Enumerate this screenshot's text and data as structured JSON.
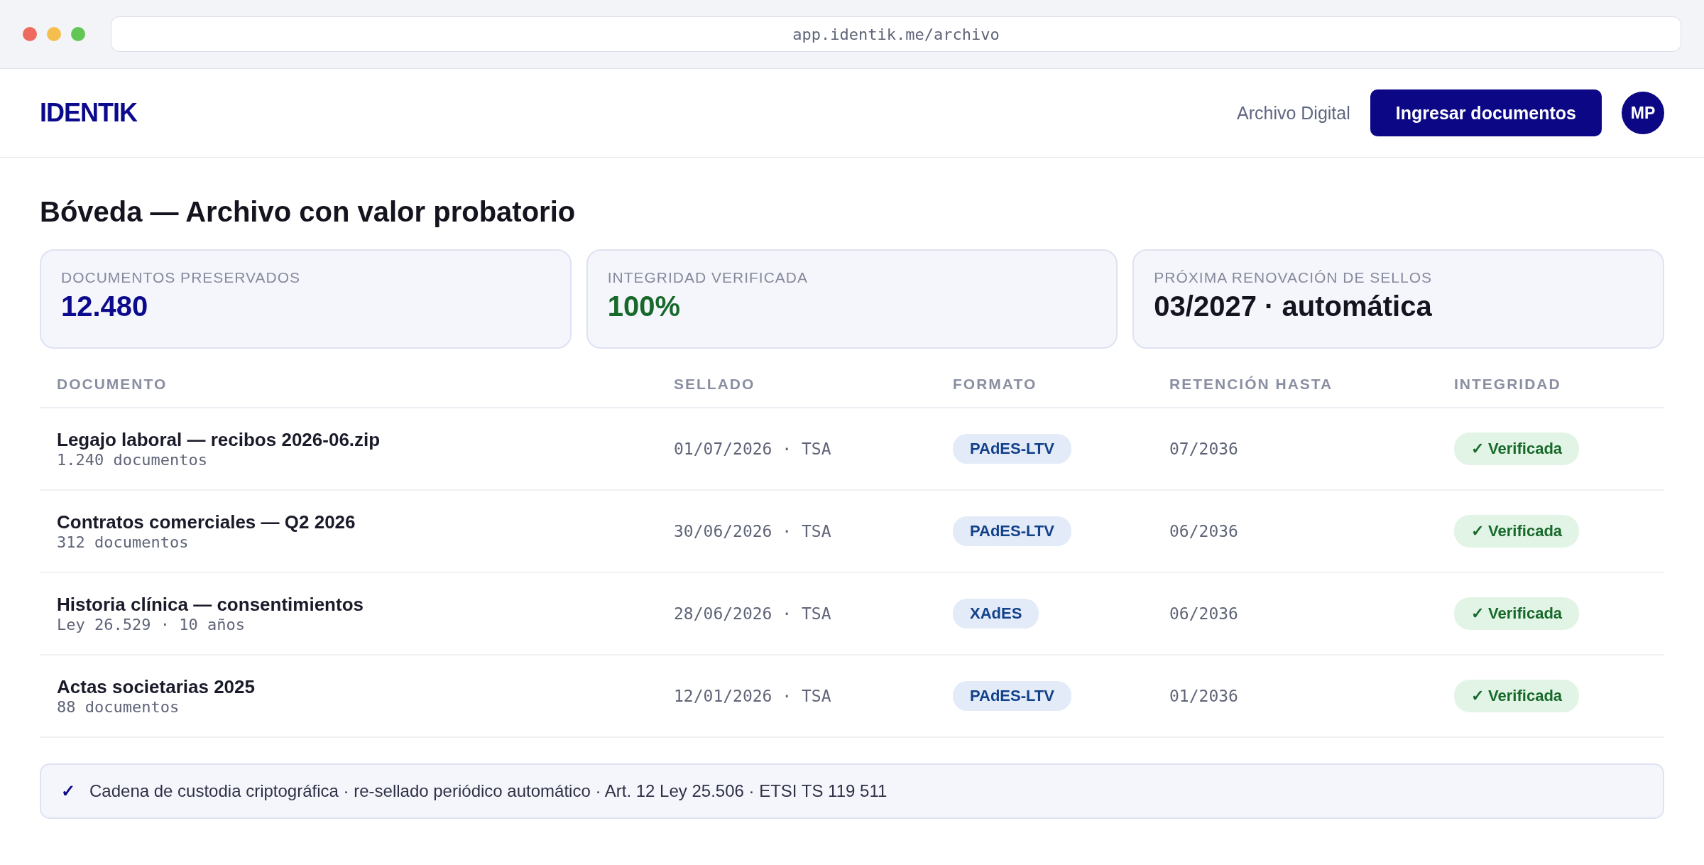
{
  "browser": {
    "url": "app.identik.me/archivo"
  },
  "header": {
    "logo": "IDENTIK",
    "nav_link": "Archivo Digital",
    "cta": "Ingresar documentos",
    "avatar": "MP"
  },
  "title": "Bóveda — Archivo con valor probatorio",
  "stats": [
    {
      "label": "DOCUMENTOS PRESERVADOS",
      "value": "12.480",
      "color": "#0b0a8c"
    },
    {
      "label": "INTEGRIDAD VERIFICADA",
      "value": "100%",
      "color": "#17692a"
    },
    {
      "label": "PRÓXIMA RENOVACIÓN DE SELLOS",
      "value": "03/2027 · automática",
      "color": "#14141f"
    }
  ],
  "table": {
    "columns": [
      "DOCUMENTO",
      "SELLADO",
      "FORMATO",
      "RETENCIÓN HASTA",
      "INTEGRIDAD"
    ],
    "rows": [
      {
        "name": "Legajo laboral — recibos 2026-06.zip",
        "detail": "1.240 documentos",
        "sealed": "01/07/2026 · TSA",
        "format": "PAdES-LTV",
        "retention": "07/2036",
        "integrity": {
          "label": "✓ Verificada",
          "verified": true
        }
      },
      {
        "name": "Contratos comerciales — Q2 2026",
        "detail": "312 documentos",
        "sealed": "30/06/2026 · TSA",
        "format": "PAdES-LTV",
        "retention": "06/2036",
        "integrity": {
          "label": "✓ Verificada",
          "verified": true
        }
      },
      {
        "name": "Historia clínica — consentimientos",
        "detail": "Ley 26.529 · 10 años",
        "sealed": "28/06/2026 · TSA",
        "format": "XAdES",
        "retention": "06/2036",
        "integrity": {
          "label": "✓ Verificada",
          "verified": true
        }
      },
      {
        "name": "Actas societarias 2025",
        "detail": "88 documentos",
        "sealed": "12/01/2026 · TSA",
        "format": "PAdES-LTV",
        "retention": "01/2036",
        "integrity": {
          "label": "✓ Verificada",
          "verified": true
        }
      }
    ]
  },
  "footer": {
    "mark": "✓",
    "text": "Cadena de custodia criptográfica · re-sellado periódico automático · Art. 12 Ley 25.506 · ETSI TS 119 511"
  }
}
